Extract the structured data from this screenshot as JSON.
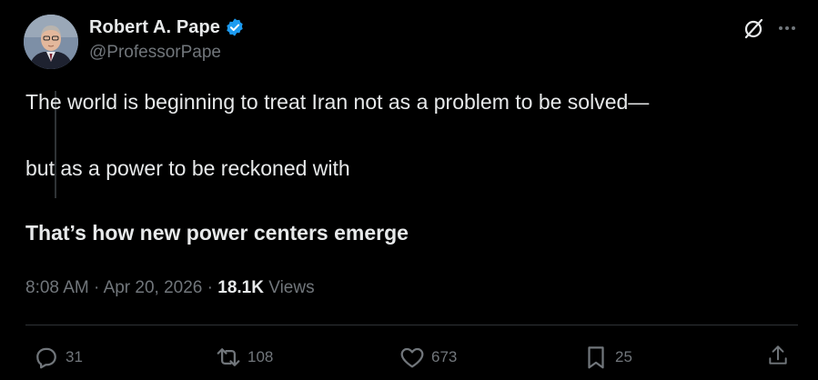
{
  "author": {
    "display_name": "Robert A. Pape",
    "handle": "@ProfessorPape",
    "verified": true
  },
  "post": {
    "line1": "The world is beginning to treat Iran not as a problem to be solved—",
    "line2": "but as a power to be reckoned with",
    "line3": "That’s how new power centers emerge"
  },
  "meta": {
    "time": "8:08 AM",
    "separator": "·",
    "date": "Apr 20, 2026",
    "views_count": "18.1K",
    "views_label": "Views"
  },
  "actions": {
    "reply_count": "31",
    "repost_count": "108",
    "like_count": "673",
    "bookmark_count": "25"
  },
  "icons": {
    "verified": "verified-badge-icon",
    "grok": "grok-icon",
    "more": "more-icon",
    "reply": "reply-icon",
    "repost": "repost-icon",
    "like": "heart-icon",
    "bookmark": "bookmark-icon",
    "share": "share-icon"
  },
  "colors": {
    "background": "#000000",
    "text_primary": "#e7e9ea",
    "text_secondary": "#71767b",
    "verified_blue": "#1d9bf0",
    "divider": "#2f3336"
  }
}
